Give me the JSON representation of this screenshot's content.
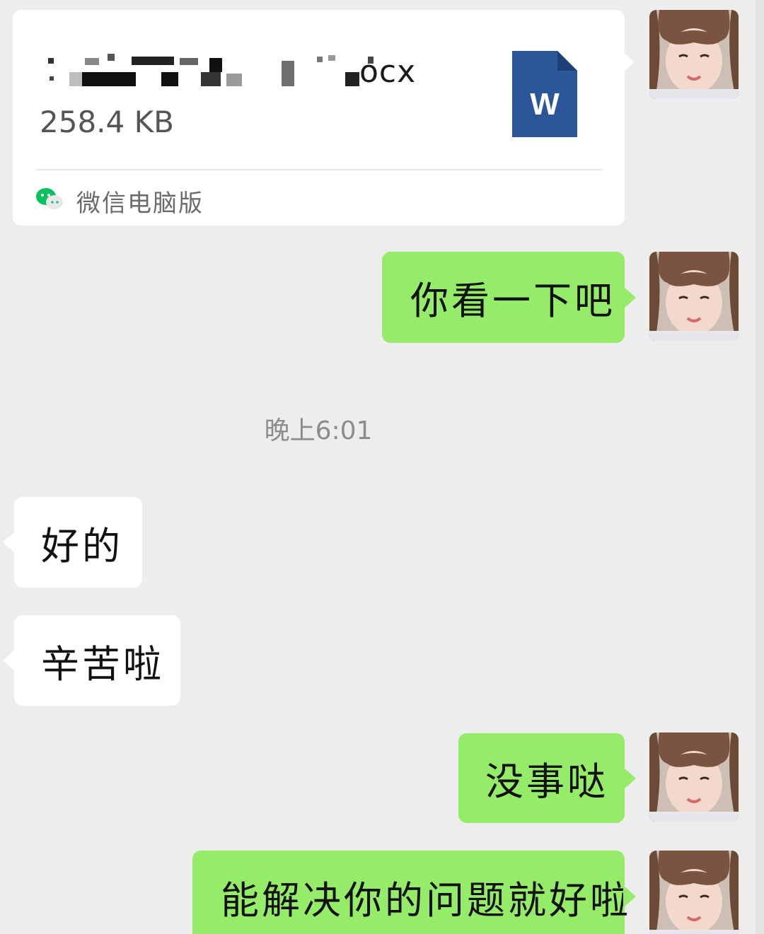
{
  "file_message": {
    "file_name_visible": "ocx",
    "file_size": "258.4 KB",
    "file_type_icon": "word-doc-icon",
    "file_icon_letter": "W",
    "source": "微信电脑版",
    "source_icon": "wechat-icon"
  },
  "messages": [
    {
      "side": "sent",
      "text": "你看一下吧"
    },
    {
      "side": "received",
      "text": "好的"
    },
    {
      "side": "received",
      "text": "辛苦啦"
    },
    {
      "side": "sent",
      "text": "没事哒"
    },
    {
      "side": "sent",
      "text": "能解决你的问题就好啦"
    }
  ],
  "timestamp": "晚上6:01",
  "colors": {
    "background": "#ededed",
    "sent_bubble": "#95ec69",
    "received_bubble": "#ffffff",
    "word_blue": "#2b579a",
    "wechat_green": "#07c160"
  }
}
